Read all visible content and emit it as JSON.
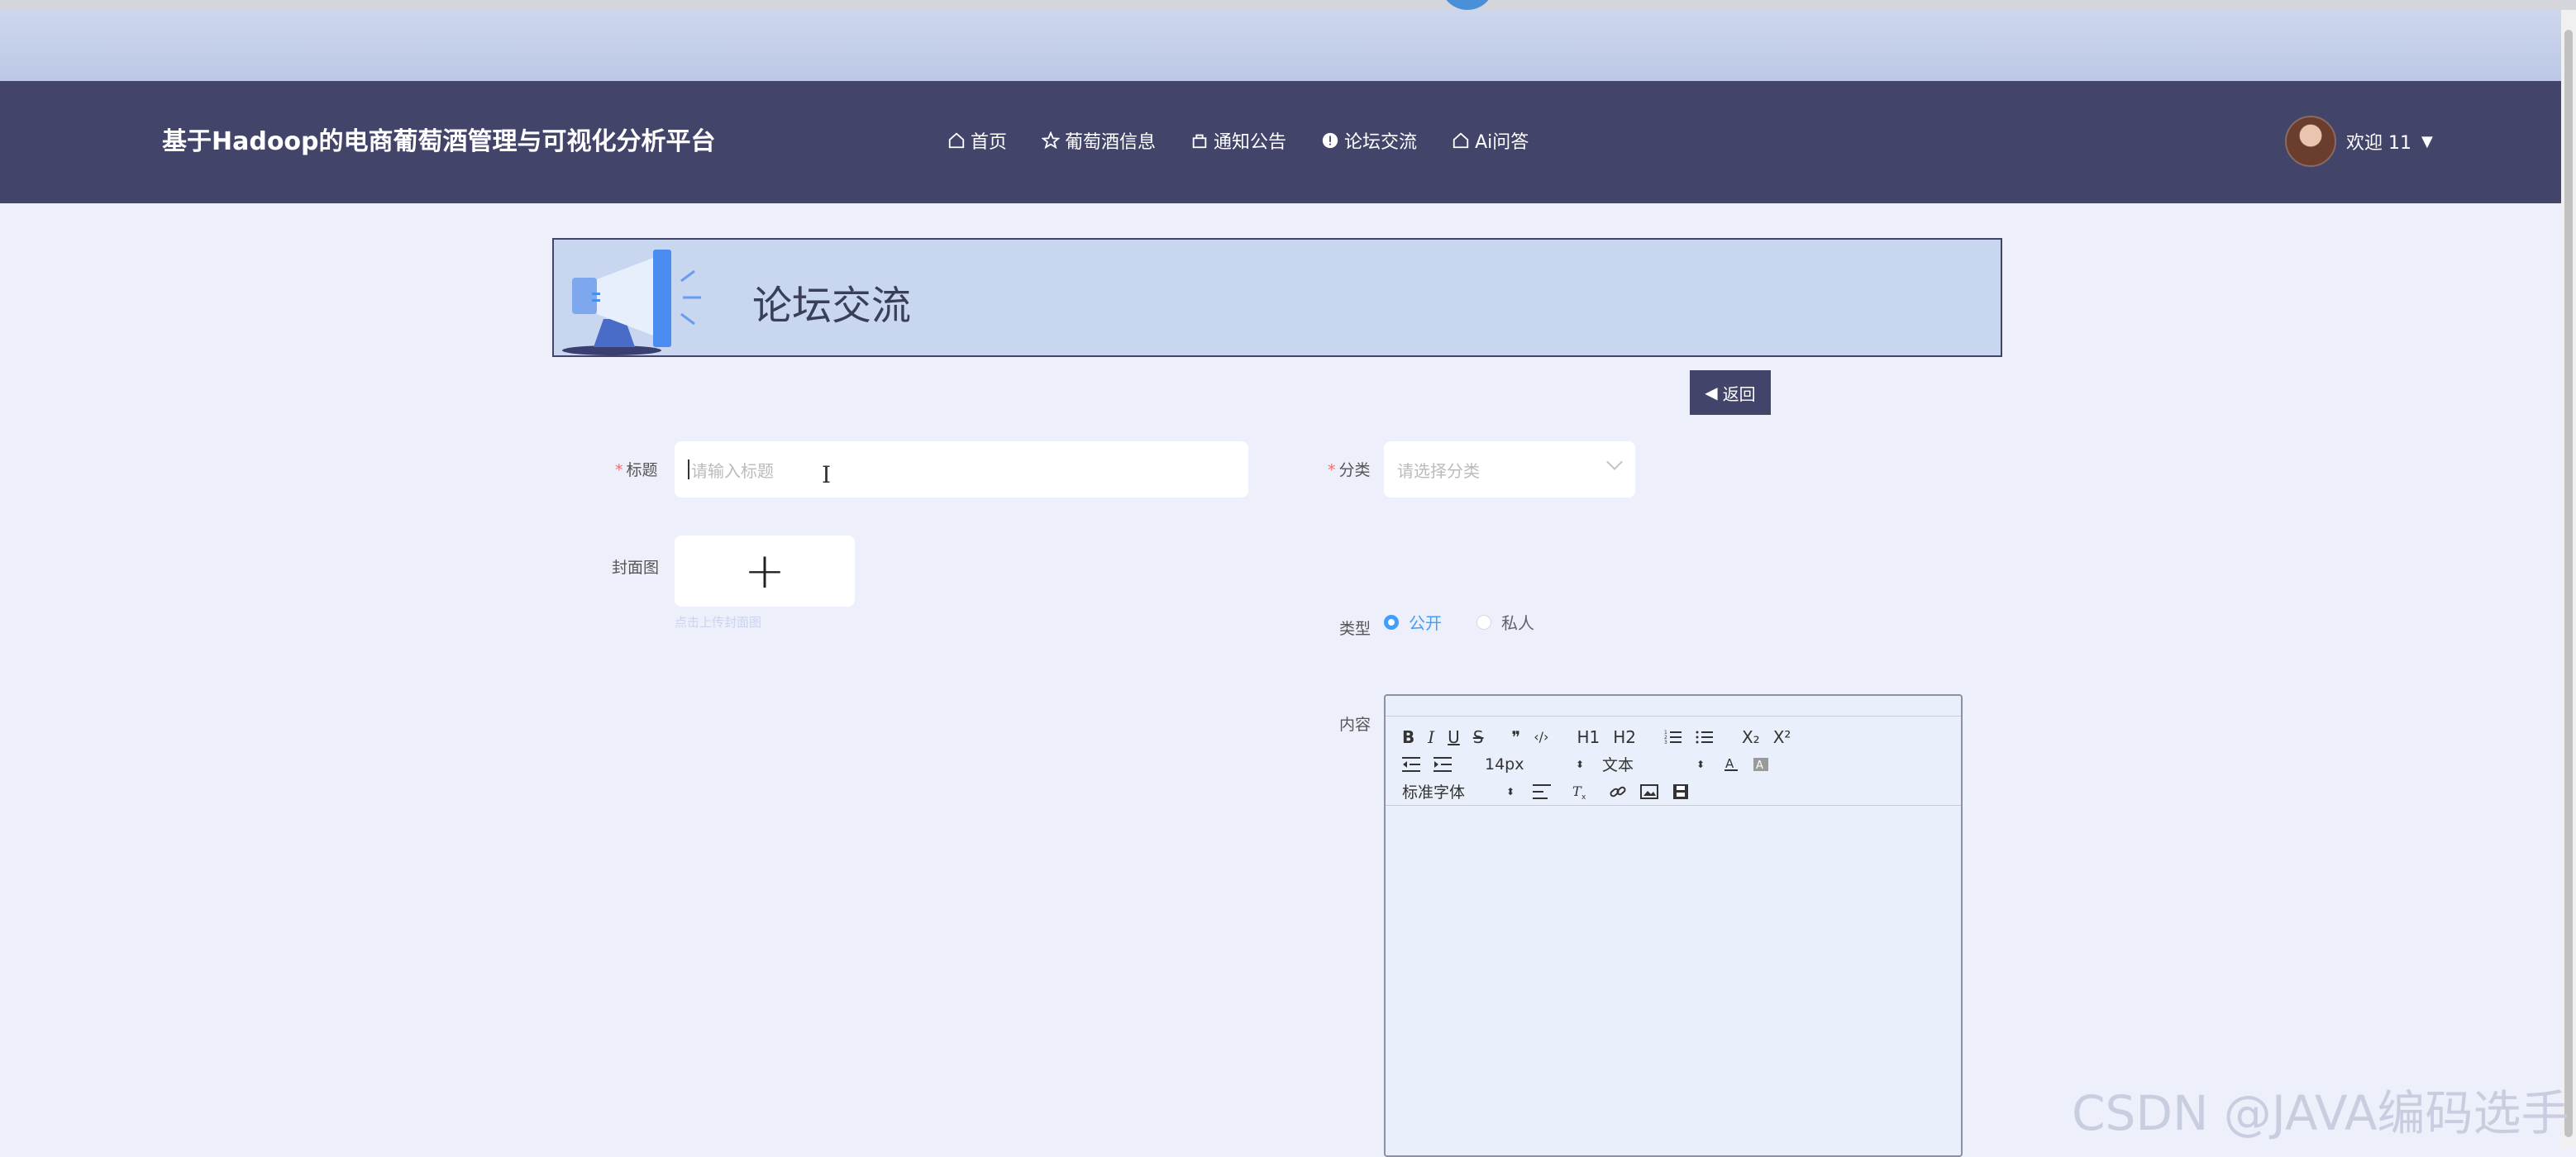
{
  "app_title": "基于Hadoop的电商葡萄酒管理与可视化分析平台",
  "nav": [
    {
      "label": "首页",
      "icon": "home-icon"
    },
    {
      "label": "葡萄酒信息",
      "icon": "star-icon"
    },
    {
      "label": "通知公告",
      "icon": "bag-icon"
    },
    {
      "label": "论坛交流",
      "icon": "info-icon"
    },
    {
      "label": "Ai问答",
      "icon": "home-icon"
    }
  ],
  "user": {
    "greeting": "欢迎 11"
  },
  "banner": {
    "title": "论坛交流"
  },
  "back_label": "返回",
  "form": {
    "title_label": "标题",
    "title_placeholder": "请输入标题",
    "category_label": "分类",
    "category_placeholder": "请选择分类",
    "cover_label": "封面图",
    "cover_tip": "点击上传封面图",
    "type_label": "类型",
    "type_options": [
      {
        "label": "公开",
        "checked": true
      },
      {
        "label": "私人",
        "checked": false
      }
    ],
    "content_label": "内容"
  },
  "editor": {
    "row1": [
      "B",
      "I",
      "U",
      "S",
      "❞",
      "‹/›",
      "H1",
      "H2",
      "ordered-list",
      "bullet-list",
      "X₂",
      "X²"
    ],
    "size_select": "14px",
    "header_select": "文本",
    "font_select": "标准字体"
  },
  "watermark": "CSDN @JAVA编码选手",
  "colors": {
    "nav_bg": "#43446a",
    "page_bg": "#edf0fa",
    "accent": "#409eff",
    "banner_bg": "#c8d6f0"
  }
}
